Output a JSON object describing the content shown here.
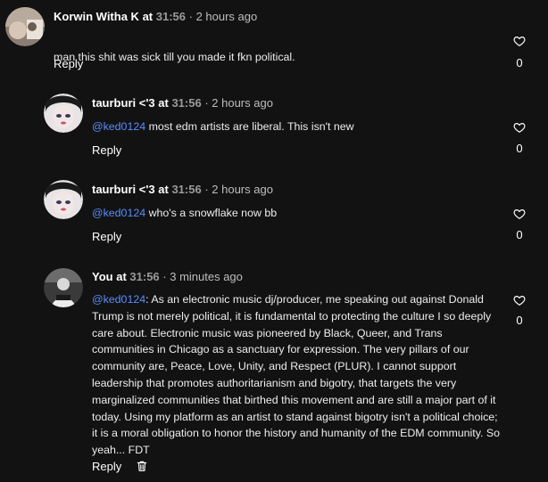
{
  "comments": [
    {
      "author": "Korwin Witha K",
      "at": "at",
      "timestamp": "31:56",
      "ago": "· 2 hours ago",
      "mention": "",
      "text": "man this shit was sick till you made it fkn political.",
      "reply_label": "Reply",
      "like_count": "0",
      "avatar_icon": "user-avatar"
    },
    {
      "author": "taurburi <'3",
      "at": "at",
      "timestamp": "31:56",
      "ago": "· 2 hours ago",
      "mention": "@ked0124",
      "text": " most edm artists are liberal. This isn't new",
      "reply_label": "Reply",
      "like_count": "0",
      "avatar_icon": "user-avatar"
    },
    {
      "author": "taurburi <'3",
      "at": "at",
      "timestamp": "31:56",
      "ago": "· 2 hours ago",
      "mention": "@ked0124",
      "text": " who's a snowflake now bb",
      "reply_label": "Reply",
      "like_count": "0",
      "avatar_icon": "user-avatar"
    },
    {
      "author": "You",
      "at": "at",
      "timestamp": "31:56",
      "ago": "· 3 minutes ago",
      "mention": "@ked0124",
      "text": ": As an electronic music dj/producer, me speaking out against Donald\nTrump is not merely political, it is fundamental to protecting the culture I so deeply\ncare about. Electronic music was pioneered by Black, Queer, and Trans\ncommunities in Chicago as a sanctuary for expression. The very pillars of our\ncommunity are, Peace, Love, Unity, and Respect (PLUR). I cannot support\nleadership that promotes authoritarianism and bigotry, that targets the very\nmarginalized communities that birthed this movement and are still a major part of it\ntoday. Using my platform as an artist to stand against bigotry isn't a political choice;\nit is a moral obligation to honor the history and humanity of the EDM community. So\nyeah... FDT",
      "reply_label": "Reply",
      "like_count": "0",
      "avatar_icon": "user-avatar",
      "delete_icon": "trash-icon"
    }
  ],
  "colors": {
    "background": "#121212",
    "mention": "#5a8dff",
    "timestamp": "#9b9b9b"
  }
}
